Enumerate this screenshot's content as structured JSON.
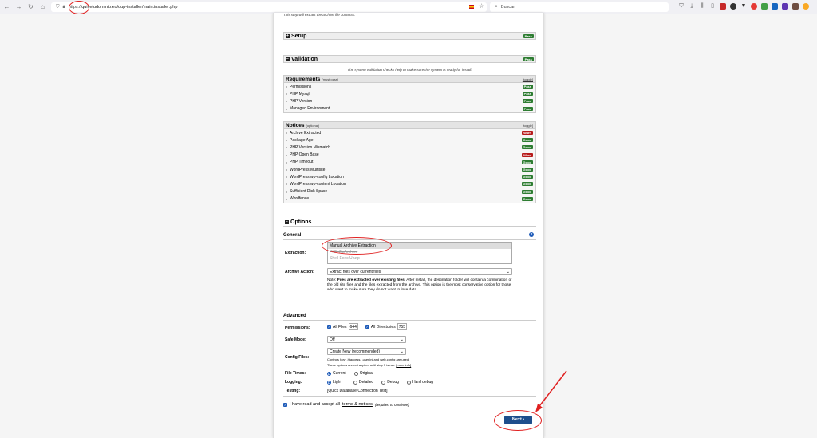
{
  "browser": {
    "url_scheme": "https://",
    "url_rest": "quivetudominio.es/dup-installer/main.installer.php",
    "search_placeholder": "Buscar"
  },
  "installer": {
    "top_note": "This step will extract the archive file contents.",
    "setup": {
      "title": "Setup",
      "status": "Pass"
    },
    "validation": {
      "title": "Validation",
      "status": "Pass",
      "note": "The system validation checks help to make sure the system is ready for install.",
      "requirements": {
        "title": "Requirements",
        "subtitle": "(must pass)",
        "toggle": "[toggle]",
        "items": [
          {
            "label": "Permissions",
            "status": "Pass"
          },
          {
            "label": "PHP Mysqli",
            "status": "Pass"
          },
          {
            "label": "PHP Version",
            "status": "Pass"
          },
          {
            "label": "Managed Environment",
            "status": "Pass"
          }
        ]
      },
      "notices": {
        "title": "Notices",
        "subtitle": "(optional)",
        "toggle": "[toggle]",
        "items": [
          {
            "label": "Archive Extracted",
            "status": "Warn"
          },
          {
            "label": "Package Age",
            "status": "Good"
          },
          {
            "label": "PHP Version Mismatch",
            "status": "Good"
          },
          {
            "label": "PHP Open Base",
            "status": "Warn"
          },
          {
            "label": "PHP Timeout",
            "status": "Good"
          },
          {
            "label": "WordPress Multisite",
            "status": "Good"
          },
          {
            "label": "WordPress wp-config Location",
            "status": "Good"
          },
          {
            "label": "WordPress wp-content Location",
            "status": "Good"
          },
          {
            "label": "Sufficient Disk Space",
            "status": "Good"
          },
          {
            "label": "Wordfence",
            "status": "Good"
          }
        ]
      }
    },
    "options": {
      "title": "Options",
      "general_label": "General",
      "extraction_label": "Extraction:",
      "extraction_options": [
        "Manual Archive Extraction",
        "PHP ZipArchive",
        "Shell Exec Unzip"
      ],
      "archive_action_label": "Archive Action:",
      "archive_action_value": "Extract files over current files",
      "note_prefix": "Note: ",
      "note_bold": "Files are extracted over existing files.",
      "note_rest": " After install, the destination folder will contain a combination of the old site files and the files extracted from the archive. This option is the most conservative option for those who want to make sure they do not want to lose data.",
      "advanced_label": "Advanced",
      "permissions_label": "Permissions:",
      "all_files_label": "All Files",
      "all_files_value": "644",
      "all_dirs_label": "All Directories",
      "all_dirs_value": "755",
      "safe_mode_label": "Safe Mode:",
      "safe_mode_value": "Off",
      "config_files_label": "Config Files:",
      "config_files_value": "Create New (recommended)",
      "config_note_1": "Controls how .htaccess, .user.ini and web.config are used.",
      "config_note_2": "These options are not applied until step 3 is ran.",
      "config_more": "[more info]",
      "file_times_label": "File Times:",
      "file_times_current": "Current",
      "file_times_original": "Original",
      "logging_label": "Logging:",
      "logging_light": "Light",
      "logging_detailed": "Detailed",
      "logging_debug": "Debug",
      "logging_hard": "Hard debug",
      "testing_label": "Testing:",
      "testing_link": "[Quick Database Connection Test]"
    },
    "accept_prefix": "I have read and accept all ",
    "accept_link": "terms & notices",
    "accept_req": "(required to continue)",
    "next_label": "Next ›"
  },
  "colors": {
    "pass": "#2e7d32",
    "warn": "#b71c1c",
    "accent": "#1e4e8c",
    "annotation": "#e02020"
  }
}
